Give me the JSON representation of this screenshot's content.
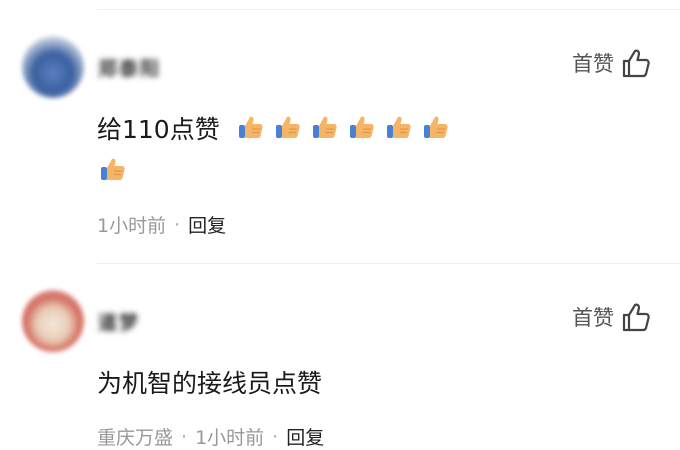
{
  "comments": [
    {
      "username": "郑泰阳",
      "like_label": "首赞",
      "text": "给110点赞",
      "emoji_count": 7,
      "time": "1小时前",
      "location": "",
      "reply_label": "回复"
    },
    {
      "username": "道梦",
      "like_label": "首赞",
      "text": "为机智的接线员点赞",
      "emoji_count": 0,
      "time": "1小时前",
      "location": "重庆万盛",
      "reply_label": "回复"
    }
  ],
  "separator": "·",
  "colors": {
    "text_primary": "#1a1a1a",
    "text_meta": "#999999",
    "thumb_emoji_skin": "#f5b567",
    "thumb_emoji_cuff": "#4a7fd6"
  },
  "icons": {
    "like": "thumb-up-outline-icon",
    "emoji": "thumbs-up-emoji"
  }
}
